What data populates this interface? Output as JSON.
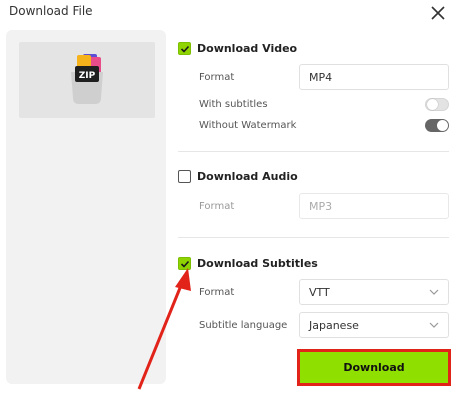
{
  "dialog": {
    "title": "Download File"
  },
  "video": {
    "label": "Download Video",
    "checked": true,
    "format_label": "Format",
    "format_value": "MP4",
    "subtitles_label": "With subtitles",
    "subtitles_on": false,
    "watermark_label": "Without Watermark",
    "watermark_on": true
  },
  "audio": {
    "label": "Download Audio",
    "checked": false,
    "format_label": "Format",
    "format_value": "MP3"
  },
  "subtitles": {
    "label": "Download Subtitles",
    "checked": true,
    "format_label": "Format",
    "format_value": "VTT",
    "language_label": "Subtitle language",
    "language_value": "Japanese"
  },
  "actions": {
    "download_label": "Download"
  },
  "preview": {
    "icon_text": "ZIP"
  },
  "colors": {
    "accent": "#8fe000",
    "highlight": "#e2231a"
  }
}
